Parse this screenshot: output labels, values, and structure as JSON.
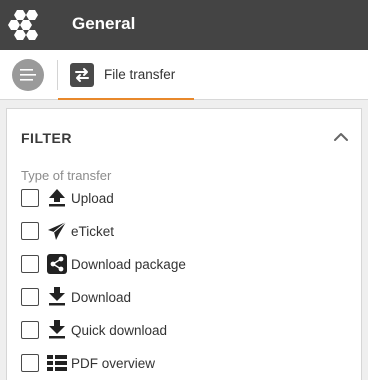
{
  "header": {
    "title": "General",
    "logo_icon": "hexagon-cluster-icon"
  },
  "tabs": [
    {
      "label": "File transfer",
      "icon": "transfer-arrows-icon",
      "active": true
    }
  ],
  "colors": {
    "header_bg": "#444444",
    "accent": "#e8882b"
  },
  "filter": {
    "title": "FILTER",
    "section_label": "Type of transfer",
    "options": [
      {
        "label": "Upload",
        "icon": "upload-icon",
        "checked": false
      },
      {
        "label": "eTicket",
        "icon": "paper-plane-icon",
        "checked": false
      },
      {
        "label": "Download package",
        "icon": "share-icon",
        "checked": false
      },
      {
        "label": "Download",
        "icon": "download-icon",
        "checked": false
      },
      {
        "label": "Quick download",
        "icon": "quick-download-icon",
        "checked": false
      },
      {
        "label": "PDF overview",
        "icon": "pdf-overview-icon",
        "checked": false
      }
    ]
  }
}
